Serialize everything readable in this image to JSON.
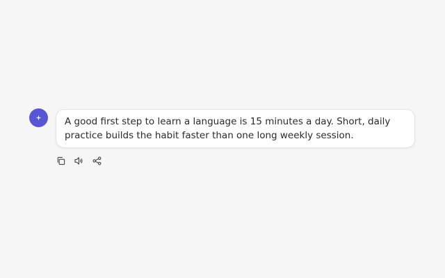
{
  "assistant": {
    "avatar_icon": "sparkle-icon",
    "accent_color": "#5856d6"
  },
  "message": {
    "text": "A good first step to learn a language is 15 minutes a day. Short, daily practice builds the habit faster than one long weekly session."
  },
  "actions": [
    {
      "icon": "copy-icon"
    },
    {
      "icon": "speaker-icon"
    },
    {
      "icon": "share-icon"
    }
  ]
}
